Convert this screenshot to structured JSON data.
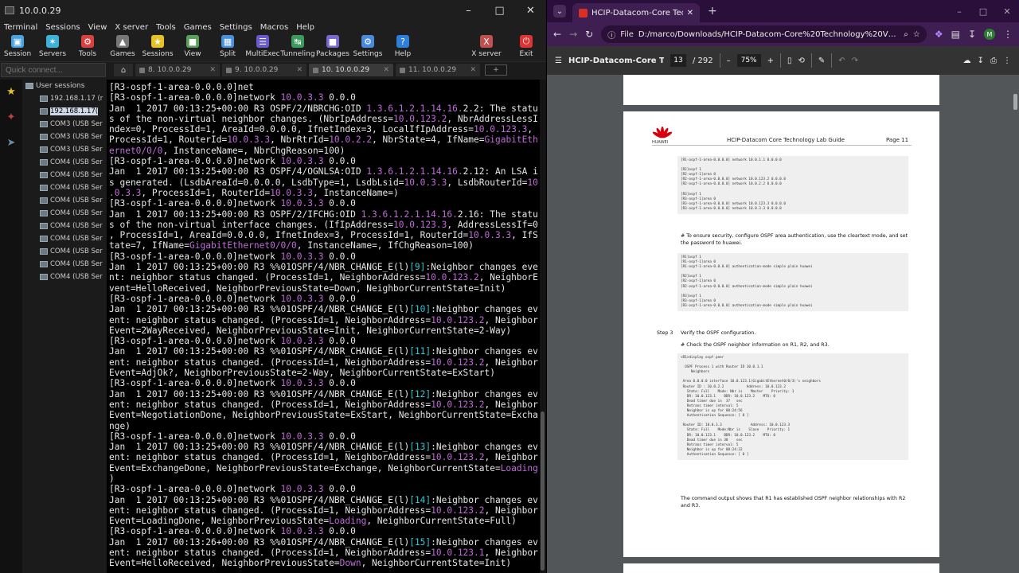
{
  "mobaxterm": {
    "window_title": "10.0.0.29",
    "menu": [
      "Terminal",
      "Sessions",
      "View",
      "X server",
      "Tools",
      "Games",
      "Settings",
      "Macros",
      "Help"
    ],
    "toolbar": [
      {
        "label": "Session",
        "icon": "session-icon",
        "color": "#4aa3df"
      },
      {
        "label": "Servers",
        "icon": "servers-icon",
        "color": "#3fb0d8"
      },
      {
        "label": "Tools",
        "icon": "tools-icon",
        "color": "#d94040"
      },
      {
        "label": "Games",
        "icon": "games-icon",
        "color": "#777777"
      },
      {
        "label": "Sessions",
        "icon": "star-icon",
        "color": "#e7c227"
      },
      {
        "label": "View",
        "icon": "view-icon",
        "color": "#5aa05a"
      },
      {
        "label": "Split",
        "icon": "split-icon",
        "color": "#4a90d9"
      },
      {
        "label": "MultiExec",
        "icon": "multiexec-icon",
        "color": "#6a5acd"
      },
      {
        "label": "Tunneling",
        "icon": "tunneling-icon",
        "color": "#3c9a5c"
      },
      {
        "label": "Packages",
        "icon": "packages-icon",
        "color": "#7a6ad0"
      },
      {
        "label": "Settings",
        "icon": "settings-icon",
        "color": "#4a8ad9"
      },
      {
        "label": "Help",
        "icon": "help-icon",
        "color": "#2f7fd8"
      }
    ],
    "toolbar_right": [
      {
        "label": "X server",
        "icon": "xserver-icon",
        "color": "#c05050"
      },
      {
        "label": "Exit",
        "icon": "exit-icon",
        "color": "#d33"
      }
    ],
    "quick_connect_placeholder": "Quick connect...",
    "tabs": [
      {
        "label": "8. 10.0.0.29",
        "active": false
      },
      {
        "label": "9. 10.0.0.29",
        "active": false
      },
      {
        "label": "10. 10.0.0.29",
        "active": true
      },
      {
        "label": "11. 10.0.0.29",
        "active": false
      }
    ],
    "tree": {
      "root": "User sessions",
      "items": [
        "192.168.1.17 (r",
        "192.168.1.17(",
        "COM3  (USB Ser",
        "COM3  (USB Ser",
        "COM3  (USB Ser",
        "COM4  (USB Ser",
        "COM4  (USB Ser",
        "COM4  (USB Ser",
        "COM4  (USB Ser",
        "COM4  (USB Ser",
        "COM4  (USB Ser",
        "COM4  (USB Ser",
        "COM4  (USB Ser",
        "COM4  (USB Ser",
        "COM4  (USB Ser"
      ],
      "selected_index": 1
    },
    "terminal_lines": [
      [
        {
          "t": "[R3-ospf-1-area-0.0.0.0]net"
        }
      ],
      [
        {
          "t": "[R3-ospf-1-area-0.0.0.0]network "
        },
        {
          "t": "10.0.3.3",
          "c": "ip"
        },
        {
          "t": " 0.0.0"
        }
      ],
      [
        {
          "t": "Jan  1 2017 00:13:25+00:00 R3 OSPF/2/NBRCHG:OID "
        },
        {
          "t": "1.3.6.1.2.1.14.16.",
          "c": "ip"
        },
        {
          "t": "2.2: The statu"
        }
      ],
      [
        {
          "t": "s of the non-virtual neighbor changes. (NbrIpAddress="
        },
        {
          "t": "10.0.123.2",
          "c": "ip"
        },
        {
          "t": ", NbrAddressLessI"
        }
      ],
      [
        {
          "t": "ndex=0, ProcessId=1, AreaId=0.0.0.0, IfnetIndex=3, LocalIfIpAddress="
        },
        {
          "t": "10.0.123.3",
          "c": "ip"
        },
        {
          "t": ","
        }
      ],
      [
        {
          "t": "ProcessId=1, RouterId="
        },
        {
          "t": "10.0.3.3",
          "c": "ip"
        },
        {
          "t": ", NbrRtrId="
        },
        {
          "t": "10.0.2.2",
          "c": "ip"
        },
        {
          "t": ", NbrState=4, IfName="
        },
        {
          "t": "GigabitEth",
          "c": "ip"
        }
      ],
      [
        {
          "t": "ernet0/0/0",
          "c": "ip"
        },
        {
          "t": ", InstanceName=, NbrChgReason=100)"
        }
      ],
      [
        {
          "t": "[R3-ospf-1-area-0.0.0.0]network "
        },
        {
          "t": "10.0.3.3",
          "c": "ip"
        },
        {
          "t": " 0.0.0"
        }
      ],
      [
        {
          "t": "Jan  1 2017 00:13:25+00:00 R3 OSPF/4/OGNLSA:OID "
        },
        {
          "t": "1.3.6.1.2.1.14.16.",
          "c": "ip"
        },
        {
          "t": "2.12: An LSA i"
        }
      ],
      [
        {
          "t": "s generated. (LsdbAreaId=0.0.0.0, LsdbType=1, LsdbLsid="
        },
        {
          "t": "10.0.3.3",
          "c": "ip"
        },
        {
          "t": ", LsdbRouterId="
        },
        {
          "t": "10",
          "c": "ip"
        }
      ],
      [
        {
          "t": ".0.3.3",
          "c": "ip"
        },
        {
          "t": ", ProcessId=1, RouterId="
        },
        {
          "t": "10.0.3.3",
          "c": "ip"
        },
        {
          "t": ", InstanceName=)"
        }
      ],
      [
        {
          "t": "[R3-ospf-1-area-0.0.0.0]network "
        },
        {
          "t": "10.0.3.3",
          "c": "ip"
        },
        {
          "t": " 0.0.0"
        }
      ],
      [
        {
          "t": "Jan  1 2017 00:13:25+00:00 R3 OSPF/2/IFCHG:OID "
        },
        {
          "t": "1.3.6.1.2.1.14.16.",
          "c": "ip"
        },
        {
          "t": "2.16: The statu"
        }
      ],
      [
        {
          "t": "s of the non-virtual interface changes. (IfIpAddress="
        },
        {
          "t": "10.0.123.3",
          "c": "ip"
        },
        {
          "t": ", AddressLessIf=0"
        }
      ],
      [
        {
          "t": ", ProcessId=1, AreaId=0.0.0.0, IfnetIndex=3, ProcessId=1, RouterId="
        },
        {
          "t": "10.0.3.3",
          "c": "ip"
        },
        {
          "t": ", IfS"
        }
      ],
      [
        {
          "t": "tate=7, IfName="
        },
        {
          "t": "GigabitEthernet0/0/0",
          "c": "ip"
        },
        {
          "t": ", InstanceName=, IfChgReason=100)"
        }
      ],
      [
        {
          "t": "[R3-ospf-1-area-0.0.0.0]network "
        },
        {
          "t": "10.0.3.3",
          "c": "ip"
        },
        {
          "t": " 0.0.0"
        }
      ],
      [
        {
          "t": "Jan  1 2017 00:13:25+00:00 R3 %%01OSPF/4/NBR_CHANGE_E(l)"
        },
        {
          "t": "[9]",
          "c": "nn"
        },
        {
          "t": ":Neighbor changes eve"
        }
      ],
      [
        {
          "t": "nt: neighbor status changed. (ProcessId=1, NeighborAddress="
        },
        {
          "t": "10.0.123.2",
          "c": "ip"
        },
        {
          "t": ", NeighborE"
        }
      ],
      [
        {
          "t": "vent=HelloReceived, NeighborPreviousState=Down, NeighborCurrentState=Init)"
        }
      ],
      [
        {
          "t": "[R3-ospf-1-area-0.0.0.0]network "
        },
        {
          "t": "10.0.3.3",
          "c": "ip"
        },
        {
          "t": " 0.0.0"
        }
      ],
      [
        {
          "t": "Jan  1 2017 00:13:25+00:00 R3 %%01OSPF/4/NBR_CHANGE_E(l)"
        },
        {
          "t": "[10]",
          "c": "nn"
        },
        {
          "t": ":Neighbor changes ev"
        }
      ],
      [
        {
          "t": "ent: neighbor status changed. (ProcessId=1, NeighborAddress="
        },
        {
          "t": "10.0.123.2",
          "c": "ip"
        },
        {
          "t": ", Neighbor"
        }
      ],
      [
        {
          "t": "Event=2WayReceived, NeighborPreviousState=Init, NeighborCurrentState=2-Way)"
        }
      ],
      [
        {
          "t": "[R3-ospf-1-area-0.0.0.0]network "
        },
        {
          "t": "10.0.3.3",
          "c": "ip"
        },
        {
          "t": " 0.0.0"
        }
      ],
      [
        {
          "t": "Jan  1 2017 00:13:25+00:00 R3 %%01OSPF/4/NBR_CHANGE_E(l)"
        },
        {
          "t": "[11]",
          "c": "nn"
        },
        {
          "t": ":Neighbor changes ev"
        }
      ],
      [
        {
          "t": "ent: neighbor status changed. (ProcessId=1, NeighborAddress="
        },
        {
          "t": "10.0.123.2",
          "c": "ip"
        },
        {
          "t": ", Neighbor"
        }
      ],
      [
        {
          "t": "Event=AdjOk?, NeighborPreviousState=2-Way, NeighborCurrentState=ExStart)"
        }
      ],
      [
        {
          "t": "[R3-ospf-1-area-0.0.0.0]network "
        },
        {
          "t": "10.0.3.3",
          "c": "ip"
        },
        {
          "t": " 0.0.0"
        }
      ],
      [
        {
          "t": "Jan  1 2017 00:13:25+00:00 R3 %%01OSPF/4/NBR_CHANGE_E(l)"
        },
        {
          "t": "[12]",
          "c": "nn"
        },
        {
          "t": ":Neighbor changes ev"
        }
      ],
      [
        {
          "t": "ent: neighbor status changed. (ProcessId=1, NeighborAddress="
        },
        {
          "t": "10.0.123.2",
          "c": "ip"
        },
        {
          "t": ", Neighbor"
        }
      ],
      [
        {
          "t": "Event=NegotiationDone, NeighborPreviousState=ExStart, NeighborCurrentState=Excha"
        }
      ],
      [
        {
          "t": "nge)"
        }
      ],
      [
        {
          "t": "[R3-ospf-1-area-0.0.0.0]network "
        },
        {
          "t": "10.0.3.3",
          "c": "ip"
        },
        {
          "t": " 0.0.0"
        }
      ],
      [
        {
          "t": "Jan  1 2017 00:13:25+00:00 R3 %%01OSPF/4/NBR_CHANGE_E(l)"
        },
        {
          "t": "[13]",
          "c": "nn"
        },
        {
          "t": ":Neighbor changes ev"
        }
      ],
      [
        {
          "t": "ent: neighbor status changed. (ProcessId=1, NeighborAddress="
        },
        {
          "t": "10.0.123.2",
          "c": "ip"
        },
        {
          "t": ", Neighbor"
        }
      ],
      [
        {
          "t": "Event=ExchangeDone, NeighborPreviousState=Exchange, NeighborCurrentState="
        },
        {
          "t": "Loading",
          "c": "ip"
        }
      ],
      [
        {
          "t": ")"
        }
      ],
      [
        {
          "t": "[R3-ospf-1-area-0.0.0.0]network "
        },
        {
          "t": "10.0.3.3",
          "c": "ip"
        },
        {
          "t": " 0.0.0"
        }
      ],
      [
        {
          "t": "Jan  1 2017 00:13:25+00:00 R3 %%01OSPF/4/NBR_CHANGE_E(l)"
        },
        {
          "t": "[14]",
          "c": "nn"
        },
        {
          "t": ":Neighbor changes ev"
        }
      ],
      [
        {
          "t": "ent: neighbor status changed. (ProcessId=1, NeighborAddress="
        },
        {
          "t": "10.0.123.2",
          "c": "ip"
        },
        {
          "t": ", Neighbor"
        }
      ],
      [
        {
          "t": "Event=LoadingDone, NeighborPreviousState="
        },
        {
          "t": "Loading",
          "c": "ip"
        },
        {
          "t": ", NeighborCurrentState=Full)"
        }
      ],
      [
        {
          "t": "[R3-ospf-1-area-0.0.0.0]network "
        },
        {
          "t": "10.0.3.3",
          "c": "ip"
        },
        {
          "t": " 0.0.0"
        }
      ],
      [
        {
          "t": "Jan  1 2017 00:13:26+00:00 R3 %%01OSPF/4/NBR_CHANGE_E(l)"
        },
        {
          "t": "[15]",
          "c": "nn"
        },
        {
          "t": ":Neighbor changes ev"
        }
      ],
      [
        {
          "t": "ent: neighbor status changed. (ProcessId=1, NeighborAddress="
        },
        {
          "t": "10.0.123.1",
          "c": "ip"
        },
        {
          "t": ", Neighbor"
        }
      ],
      [
        {
          "t": "Event=HelloReceived, NeighborPreviousState="
        },
        {
          "t": "Down",
          "c": "ip"
        },
        {
          "t": ", NeighborCurrentState=Init)"
        }
      ]
    ]
  },
  "chrome": {
    "tab_title": "HCIP-Datacom-Core Technolog",
    "address_scheme": "File",
    "address_url": "D:/marco/Downloads/HCIP-Datacom-Core%20Technology%20V1.0...",
    "profile_initial": "M",
    "profile_color": "#2e7d32",
    "pdf": {
      "title": "HCIP-Datacom-Core T...",
      "page_current": "13",
      "page_total": "/ 292",
      "zoom": "75%",
      "page": {
        "brand": "HUAWEI",
        "header_title": "HCIP-Datacom Core Technology Lab Guide",
        "header_page": "Page 11",
        "code_block_1": "[R1-ospf-1-area-0.0.0.0] network 10.0.1.1 0.0.0.0\n\n[R2]ospf 1\n[R2-ospf-1]area 0\n[R2-ospf-1-area-0.0.0.0] network 10.0.123.2 0.0.0.0\n[R2-ospf-1-area-0.0.0.0] network 10.0.2.2 0.0.0.0\n\n[R3]ospf 1\n[R3-ospf-1]area 0\n[R3-ospf-1-area-0.0.0.0] network 10.0.123.3 0.0.0.0\n[R3-ospf-1-area-0.0.0.0] network 10.0.3.3 0.0.0.0",
        "para_1": "# To ensure security, configure OSPF area authentication, use the cleartext mode, and set the password to huawei.",
        "code_block_2": "[R1]ospf 1\n[R1-ospf-1]area 0\n[R1-ospf-1-area-0.0.0.0] authentication-mode simple plain huawei\n\n[R2]ospf 1\n[R2-ospf-1]area 0\n[R2-ospf-1-area-0.0.0.0] authentication-mode simple plain huawei\n\n[R3]ospf 1\n[R3-ospf-1]area 0\n[R3-ospf-1-area-0.0.0.0] authentication-mode simple plain huawei",
        "step_label": "Step 3",
        "step_text": "Verify the OSPF configuration.",
        "para_2": "# Check the OSPF neighbor information on R1, R2, and R3.",
        "code_block_3": "<R1>display ospf peer\n\n  OSPF Process 1 with Router ID 10.0.1.1\n     Neighbors\n\n Area 0.0.0.0 interface 10.0.123.1(GigabitEthernet0/0/3)'s neighbors\n Router ID : 10.0.2.2           Address: 10.0.123.2\n   State: Full    Mode: Nbr is    Master    Priority: 1\n   DR: 10.0.123.1    BDR: 10.0.123.2    MTU: 0\n   Dead timer due in  37   sec\n   Retrans timer interval: 5\n   Neighbor is up for 00:24:56\n   Authentication Sequence: [ 0 ]\n\n Router ID: 10.0.3.3              Address: 10.0.123.3\n   State: Full    Mode:Nbr is    Slave    Priority: 1\n   DR: 10.0.123.1    BDR: 10.0.123.2    MTU: 0\n   Dead timer due in 38    sec\n   Retrans timer interval: 5\n   Neighbor is up for 00:24:32\n   Authentication Sequence: [ 0 ]",
        "para_3": "The command output shows that R1 has established OSPF neighbor relationships with R2 and R3."
      }
    }
  }
}
